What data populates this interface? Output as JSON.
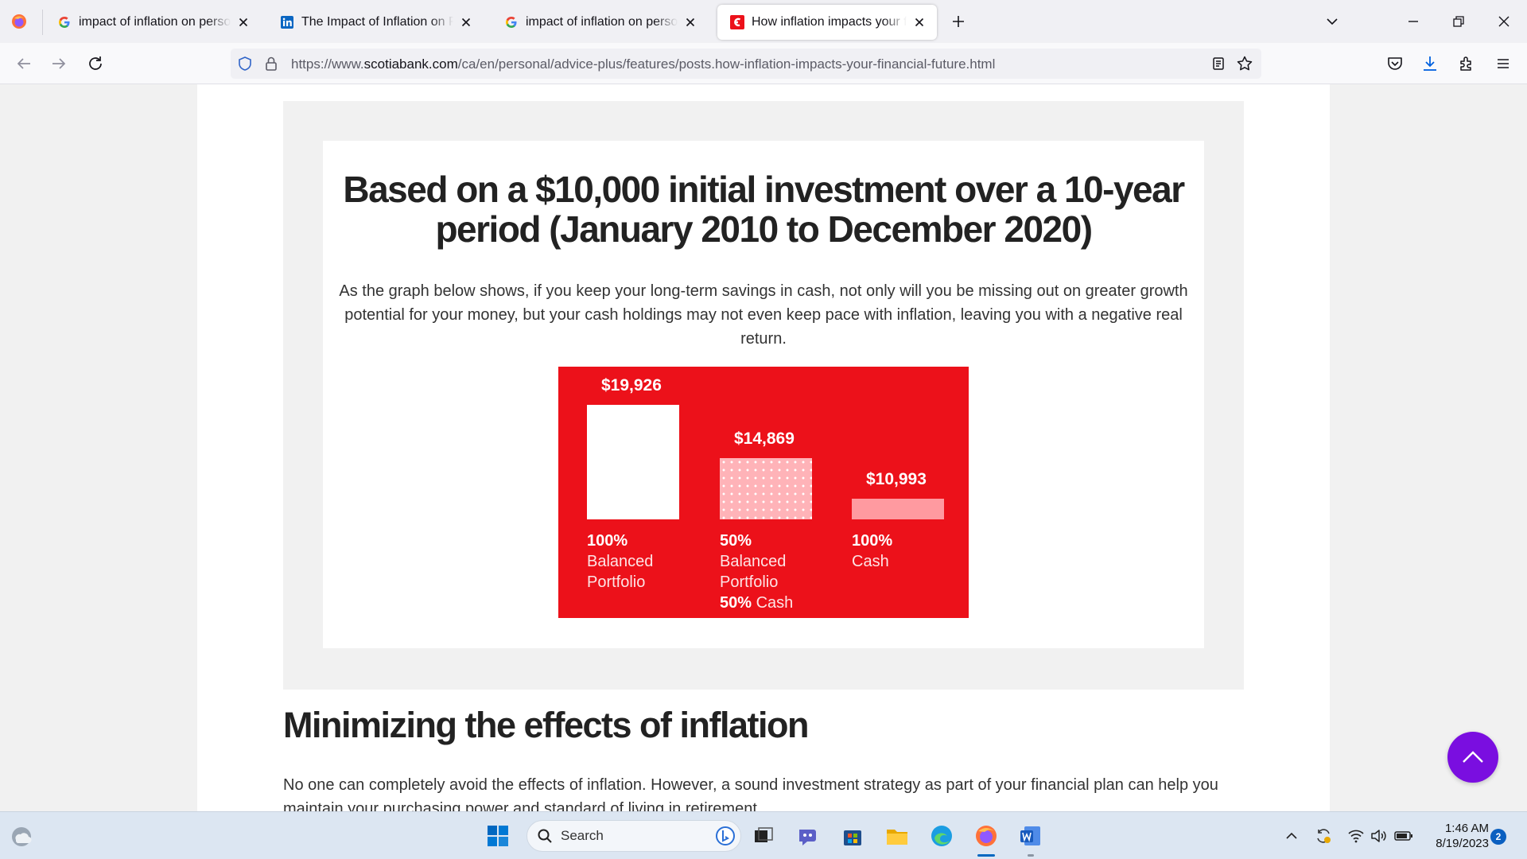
{
  "browser": {
    "tabs": [
      {
        "label": "impact of inflation on personal finance - Google Search",
        "favicon": "google-icon",
        "active": false
      },
      {
        "label": "The Impact of Inflation on Personal Finance | LinkedIn",
        "favicon": "linkedin-icon",
        "active": false
      },
      {
        "label": "impact of inflation on personal finance - Google Search",
        "favicon": "google-icon",
        "active": false
      },
      {
        "label": "How inflation impacts your financial future",
        "favicon": "scotiabank-icon",
        "active": true
      }
    ],
    "url": {
      "prefix": "https://www.",
      "domain": "scotiabank.com",
      "path": "/ca/en/personal/advice-plus/features/posts.how-inflation-impacts-your-financial-future.html"
    }
  },
  "article": {
    "card_title": "Based on a $10,000 initial investment over a 10-year period (January 2010 to December 2020)",
    "card_description": "As the graph below shows, if you keep your long-term savings in cash, not only will you be missing out on greater growth potential for your money, but your cash holdings may not even keep pace with inflation, leaving you with a negative real return.",
    "section_heading": "Minimizing the effects of inflation",
    "section_text": "No one can completely avoid the effects of inflation. However, a sound investment strategy as part of your financial plan can help you maintain your purchasing power and standard of living in retirement."
  },
  "chart_data": {
    "type": "bar",
    "categories": [
      "100% Balanced Portfolio",
      "50% Balanced Portfolio 50% Cash",
      "100% Cash"
    ],
    "values": [
      19926,
      14869,
      10993
    ],
    "value_labels": [
      "$19,926",
      "$14,869",
      "$10,993"
    ],
    "ylim": [
      9000,
      20000
    ],
    "grid": false,
    "colors": {
      "background": "#ec111a",
      "bar_1": "#ffffff",
      "bar_2": "#ffb3b8",
      "bar_3": "#ff9aa0"
    },
    "category_labels": [
      {
        "pct": "100%",
        "lines": [
          "Balanced",
          "Portfolio"
        ]
      },
      {
        "pct": "50%",
        "lines": [
          "Balanced",
          "Portfolio"
        ],
        "pct2": "50%",
        "extra": "Cash"
      },
      {
        "pct": "100%",
        "lines": [
          "Cash"
        ]
      }
    ]
  },
  "taskbar": {
    "search_label": "Search",
    "time": "1:46 AM",
    "date": "8/19/2023",
    "notification_count": "2"
  },
  "colors": {
    "brand_red": "#ec111a",
    "scroll_button": "#7a0ee0",
    "link_blue": "#0060df"
  }
}
